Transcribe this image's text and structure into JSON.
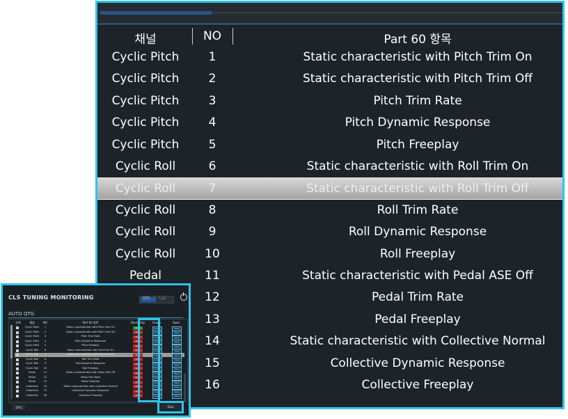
{
  "big": {
    "headers": {
      "channel": "채널",
      "no": "NO",
      "item": "Part 60 항목"
    },
    "rows": [
      {
        "channel": "Cyclic Pitch",
        "no": "1",
        "item": "Static characteristic with Pitch Trim On"
      },
      {
        "channel": "Cyclic Pitch",
        "no": "2",
        "item": "Static characteristic with Pitch Trim Off"
      },
      {
        "channel": "Cyclic Pitch",
        "no": "3",
        "item": "Pitch Trim Rate"
      },
      {
        "channel": "Cyclic Pitch",
        "no": "4",
        "item": "Pitch Dynamic Response"
      },
      {
        "channel": "Cyclic Pitch",
        "no": "5",
        "item": "Pitch Freeplay"
      },
      {
        "channel": "Cyclic Roll",
        "no": "6",
        "item": "Static characteristic with Roll Trim On"
      },
      {
        "channel": "Cyclic Roll",
        "no": "7",
        "item": "Static characteristic with Roll Trim Off"
      },
      {
        "channel": "Cyclic Roll",
        "no": "8",
        "item": "Roll Trim Rate"
      },
      {
        "channel": "Cyclic Roll",
        "no": "9",
        "item": "Roll Dynamic Response"
      },
      {
        "channel": "Cyclic Roll",
        "no": "10",
        "item": "Roll Freeplay"
      },
      {
        "channel": "Pedal",
        "no": "11",
        "item": "Static characteristic with Pedal ASE Off"
      },
      {
        "channel": "",
        "no": "12",
        "item": "Pedal Trim Rate"
      },
      {
        "channel": "",
        "no": "13",
        "item": "Pedal Freeplay"
      },
      {
        "channel": "",
        "no": "14",
        "item": "Static characteristic with Collective Normal"
      },
      {
        "channel": "",
        "no": "15",
        "item": "Collective Dynamic Response"
      },
      {
        "channel": "",
        "no": "16",
        "item": "Collective Freeplay"
      }
    ],
    "selected_index": 6
  },
  "small": {
    "title": "CLS TUNING MONITORING",
    "toggle": {
      "on_label": "QTG",
      "off_label": "Lab"
    },
    "section": "AUTO QTG",
    "headers": {
      "select": "선택",
      "channel": "채널",
      "no": "NO",
      "item": "Part 60 항목",
      "status": "Start/Stop",
      "graph": "Graph",
      "save": "Save"
    },
    "rows": [
      {
        "channel": "Cyclic Pitch",
        "no": "1",
        "item": "Static characteristic with Pitch Trim On",
        "status": "Start",
        "status_ok": true
      },
      {
        "channel": "Cyclic Pitch",
        "no": "2",
        "item": "Static characteristic with Pitch Trim Off",
        "status": "Start",
        "status_ok": false
      },
      {
        "channel": "Cyclic Pitch",
        "no": "3",
        "item": "Pitch Trim Rate",
        "status": "Start",
        "status_ok": false
      },
      {
        "channel": "Cyclic Pitch",
        "no": "4",
        "item": "Pitch Dynamic Response",
        "status": "Start",
        "status_ok": false
      },
      {
        "channel": "Cyclic Pitch",
        "no": "5",
        "item": "Pitch Freeplay",
        "status": "Start",
        "status_ok": false
      },
      {
        "channel": "Cyclic Roll",
        "no": "6",
        "item": "Static characteristic with Roll Trim On",
        "status": "Start",
        "status_ok": false
      },
      {
        "channel": "Cyclic Roll",
        "no": "7",
        "item": "Static characteristic with Roll Trim Off",
        "status": "Start",
        "status_ok": false
      },
      {
        "channel": "Cyclic Roll",
        "no": "8",
        "item": "Roll Trim Rate",
        "status": "Start",
        "status_ok": false
      },
      {
        "channel": "Cyclic Roll",
        "no": "9",
        "item": "Roll Dynamic Response",
        "status": "Start",
        "status_ok": false
      },
      {
        "channel": "Cyclic Roll",
        "no": "10",
        "item": "Roll Freeplay",
        "status": "Start",
        "status_ok": false
      },
      {
        "channel": "Pedal",
        "no": "11",
        "item": "Static characteristic with Pedal ASE Off",
        "status": "Start",
        "status_ok": false
      },
      {
        "channel": "Pedal",
        "no": "12",
        "item": "Pedal Trim Rate",
        "status": "Start",
        "status_ok": false
      },
      {
        "channel": "Pedal",
        "no": "13",
        "item": "Pedal Freeplay",
        "status": "Start",
        "status_ok": false
      },
      {
        "channel": "Collective",
        "no": "14",
        "item": "Static characteristic with Collective Normal",
        "status": "Start",
        "status_ok": false
      },
      {
        "channel": "Collective",
        "no": "15",
        "item": "Collective Dynamic Response",
        "status": "Start",
        "status_ok": false
      },
      {
        "channel": "Collective",
        "no": "16",
        "item": "Collective Freeplay",
        "status": "Start",
        "status_ok": false
      }
    ],
    "selected_index": 6,
    "graph_label": "Graph",
    "save_label": "Save",
    "dcn_label": "DAQ",
    "stop_label": "Stop"
  },
  "colors": {
    "accent_border": "#2ec4ec",
    "panel_bg": "#1d2429",
    "start_red": "#c4242a",
    "start_green": "#2f8f2f",
    "selected_row": "#b4b4b4"
  }
}
